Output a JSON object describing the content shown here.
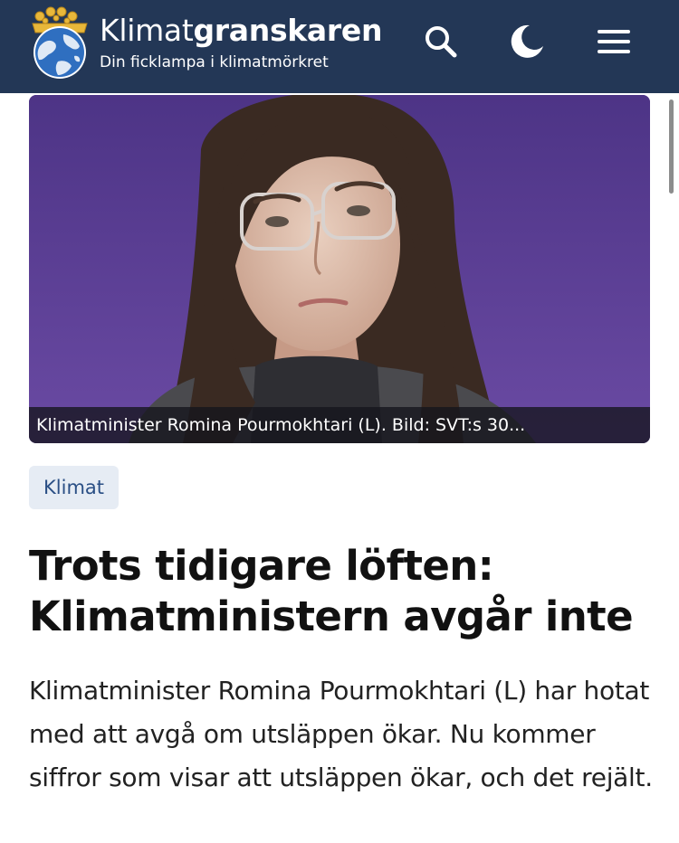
{
  "header": {
    "brand_light": "Klimat",
    "brand_bold": "granskaren",
    "tagline": "Din ficklampa i klimatmörkret",
    "icons": {
      "logo": "globe-crown-logo",
      "search": "search-icon",
      "theme": "moon-icon",
      "menu": "hamburger-menu-icon"
    },
    "colors": {
      "background": "#233756",
      "text": "#ffffff"
    }
  },
  "article": {
    "image_caption": "Klimatminister Romina Pourmokhtari (L). Bild: SVT:s 30...",
    "category": "Klimat",
    "headline": "Trots tidigare löften: Klimatministern avgår inte",
    "lead": "Klimatminister Romina Pourmokhtari (L) har hotat med att avgå om utsläppen ökar. Nu kommer siffror som visar att utsläppen ökar, och det rejält."
  },
  "colors": {
    "tag_background": "#e6ecf4",
    "tag_text": "#2a4f85",
    "headline": "#111111",
    "body_text": "#222222"
  }
}
